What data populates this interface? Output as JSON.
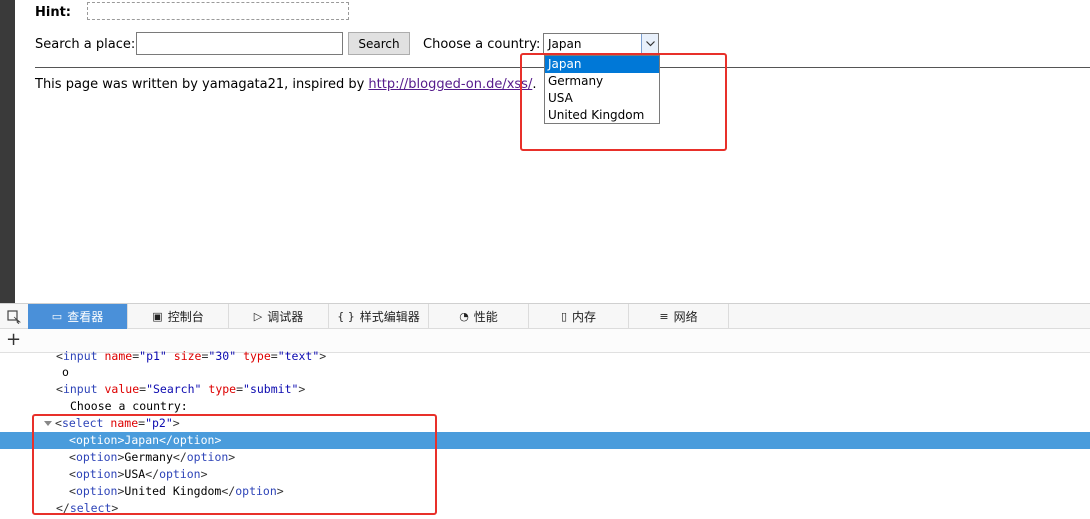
{
  "page": {
    "hint_label": "Hint:",
    "search_label": "Search a place:",
    "search_input_value": "",
    "search_button_label": "Search",
    "country_label": "Choose a country:",
    "country_selected": "Japan",
    "country_options": [
      "Japan",
      "Germany",
      "USA",
      "United Kingdom"
    ],
    "footer_text": "This page was written by yamagata21, inspired by ",
    "footer_link": "http://blogged-on.de/xss/",
    "footer_end": "."
  },
  "devtools": {
    "tabs": [
      {
        "icon": "inspector-icon",
        "label": "查看器",
        "active": true
      },
      {
        "icon": "console-icon",
        "label": "控制台"
      },
      {
        "icon": "debugger-icon",
        "label": "调试器"
      },
      {
        "icon": "style-editor-icon",
        "label": "样式编辑器"
      },
      {
        "icon": "performance-icon",
        "label": "性能"
      },
      {
        "icon": "memory-icon",
        "label": "内存"
      },
      {
        "icon": "network-icon",
        "label": "网络"
      }
    ],
    "code": {
      "l0_tag": "input",
      "l0_a1": "name",
      "l0_v1": "\"p1\"",
      "l0_a2": "size",
      "l0_v2": "\"30\"",
      "l0_a3": "type",
      "l0_v3": "\"text\"",
      "l1_text": "o",
      "l2_tag": "input",
      "l2_a1": "value",
      "l2_v1": "\"Search\"",
      "l2_a2": "type",
      "l2_v2": "\"submit\"",
      "l3_text": "Choose a country:",
      "l4_tag": "select",
      "l4_a1": "name",
      "l4_v1": "\"p2\"",
      "option_tag": "option",
      "options": [
        "Japan",
        "Germany",
        "USA",
        "United Kingdom"
      ],
      "close_tag": "select"
    }
  },
  "colors": {
    "highlight_red": "#e8302a",
    "dropdown_selected": "#0078d7",
    "devtools_selected_row": "#4a9cdc",
    "devtools_active_tab": "#4a90d9",
    "link_visited": "#551a8b"
  }
}
